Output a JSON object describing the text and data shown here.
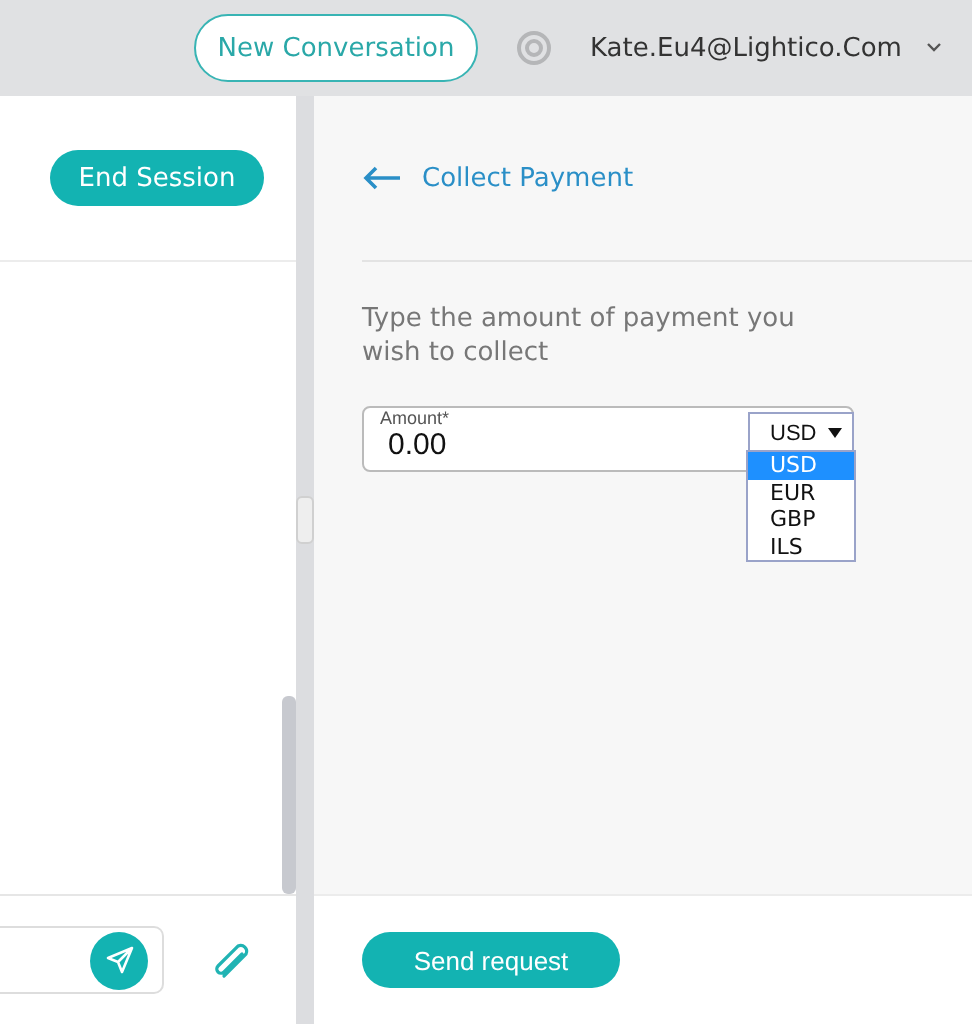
{
  "top_bar": {
    "new_conversation_button": "New Conversation",
    "user_email": "Kate.Eu4@Lightico.Com"
  },
  "session_panel": {
    "end_session_button": "End Session"
  },
  "payment_panel": {
    "title": "Collect Payment",
    "instruction": "Type the amount of payment you wish to collect",
    "amount_field": {
      "label": "Amount*",
      "value": "0.00"
    },
    "currency": {
      "value": "USD",
      "expanded": true,
      "options": [
        {
          "label": "USD",
          "selected": true
        },
        {
          "label": "EUR",
          "selected": false
        },
        {
          "label": "GBP",
          "selected": false
        },
        {
          "label": "ILS",
          "selected": false
        }
      ]
    },
    "send_button": "Send request"
  }
}
